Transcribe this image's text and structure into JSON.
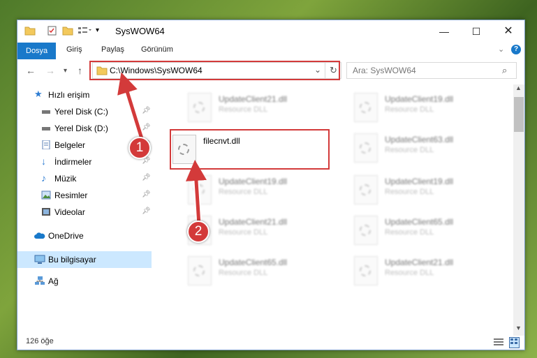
{
  "window": {
    "title": "SysWOW64",
    "min_icon": "minimize-icon",
    "max_icon": "maximize-icon",
    "close_icon": "close-icon"
  },
  "ribbon": {
    "tabs": [
      "Dosya",
      "Giriş",
      "Paylaş",
      "Görünüm"
    ]
  },
  "address": {
    "path": "C:\\Windows\\SysWOW64",
    "search_placeholder": "Ara: SysWOW64"
  },
  "sidebar": {
    "items": [
      {
        "label": "Hızlı erişim",
        "icon": "star-icon"
      },
      {
        "label": "Yerel Disk (C:)",
        "icon": "drive-icon",
        "pinned": true
      },
      {
        "label": "Yerel Disk (D:)",
        "icon": "drive-icon",
        "pinned": true
      },
      {
        "label": "Belgeler",
        "icon": "documents-icon",
        "pinned": true
      },
      {
        "label": "İndirmeler",
        "icon": "download-icon",
        "pinned": true
      },
      {
        "label": "Müzik",
        "icon": "music-icon",
        "pinned": true
      },
      {
        "label": "Resimler",
        "icon": "pictures-icon",
        "pinned": true
      },
      {
        "label": "Videolar",
        "icon": "videos-icon",
        "pinned": true
      },
      {
        "label": "OneDrive",
        "icon": "cloud-icon"
      },
      {
        "label": "Bu bilgisayar",
        "icon": "computer-icon",
        "selected": true
      },
      {
        "label": "Ağ",
        "icon": "network-icon"
      }
    ]
  },
  "files": {
    "highlighted": {
      "name": "filecnvt.dll"
    },
    "blurred": [
      {
        "name": "UpdateClient21.dll",
        "desc": "Resource DLL"
      },
      {
        "name": "UpdateClient19.dll",
        "desc": "Resource DLL"
      },
      {
        "name": "UpdateClient63.dll",
        "desc": "Resource DLL"
      },
      {
        "name": "UpdateClient19.dll",
        "desc": "Resource DLL"
      },
      {
        "name": "UpdateClient19.dll",
        "desc": "Resource DLL"
      },
      {
        "name": "UpdateClient21.dll",
        "desc": "Resource DLL"
      },
      {
        "name": "UpdateClient65.dll",
        "desc": "Resource DLL"
      },
      {
        "name": "UpdateClient65.dll",
        "desc": "Resource DLL"
      },
      {
        "name": "UpdateClient21.dll",
        "desc": "Resource DLL"
      }
    ]
  },
  "status": {
    "count": "126 öğe"
  },
  "annotations": {
    "badge1": "1",
    "badge2": "2"
  },
  "colors": {
    "accent": "#1979ca",
    "annotation_red": "#d33a3a",
    "selected_bg": "#cce8ff"
  }
}
